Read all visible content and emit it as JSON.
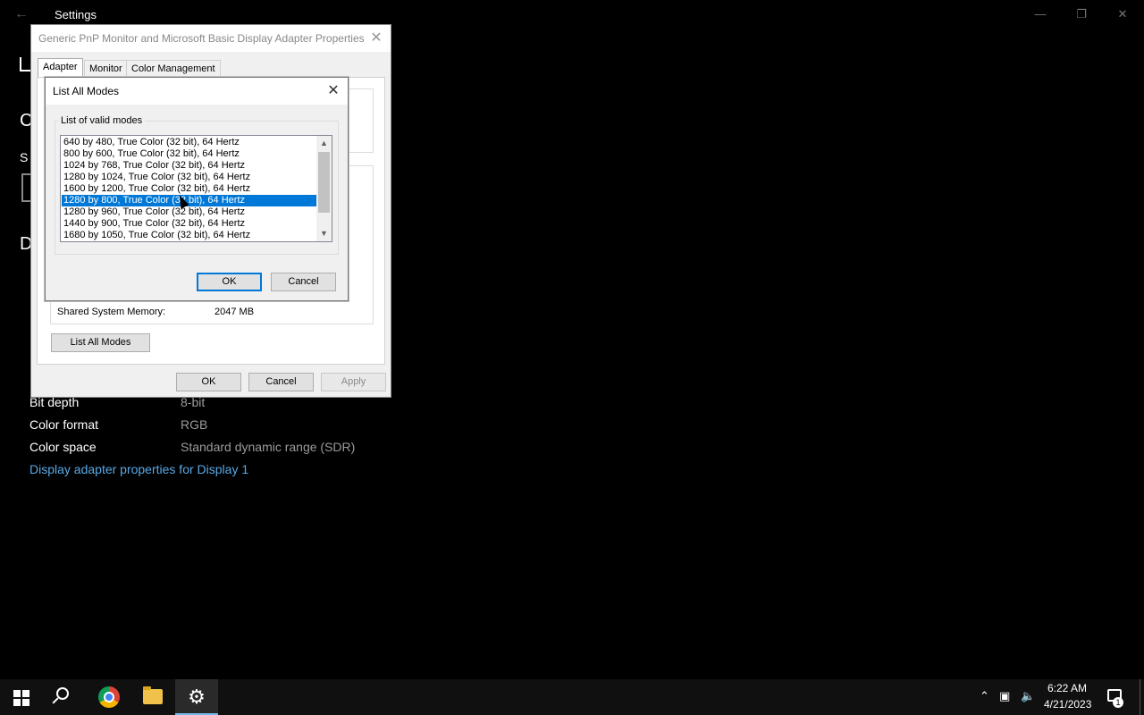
{
  "settings": {
    "title": "Settings",
    "sidebar_fragments": [
      "C",
      "S",
      "D"
    ],
    "info_rows": [
      {
        "label": "Bit depth",
        "value": "8-bit"
      },
      {
        "label": "Color format",
        "value": "RGB"
      },
      {
        "label": "Color space",
        "value": "Standard dynamic range (SDR)"
      }
    ],
    "adapter_link": "Display adapter properties for Display 1"
  },
  "properties_dialog": {
    "title": "Generic PnP Monitor and Microsoft Basic Display Adapter Properties",
    "tabs": [
      "Adapter",
      "Monitor",
      "Color Management"
    ],
    "shared_memory_label": "Shared System Memory:",
    "shared_memory_value": "2047 MB",
    "list_all_modes_button": "List All Modes",
    "ok_button": "OK",
    "cancel_button": "Cancel",
    "apply_button": "Apply"
  },
  "modes_dialog": {
    "title": "List All Modes",
    "group_label": "List of valid modes",
    "modes": [
      "640 by 480, True Color (32 bit), 64 Hertz",
      "800 by 600, True Color (32 bit), 64 Hertz",
      "1024 by 768, True Color (32 bit), 64 Hertz",
      "1280 by 1024, True Color (32 bit), 64 Hertz",
      "1600 by 1200, True Color (32 bit), 64 Hertz",
      "1280 by 800, True Color (32 bit), 64 Hertz",
      "1280 by 960, True Color (32 bit), 64 Hertz",
      "1440 by 900, True Color (32 bit), 64 Hertz",
      "1680 by 1050, True Color (32 bit), 64 Hertz"
    ],
    "selected_mode": "1280 by 800, True Color (32 bit), 64 Hertz",
    "ok_button": "OK",
    "cancel_button": "Cancel"
  },
  "taskbar": {
    "apps": [
      "start-icon",
      "search-icon",
      "chrome-icon",
      "file-explorer-icon",
      "settings-icon"
    ],
    "active_app": "settings-icon",
    "time": "6:22 AM",
    "date": "4/21/2023",
    "notification_count": "1"
  },
  "colors": {
    "accent": "#0078d7",
    "link": "#5aa9e6",
    "background": "#000000"
  }
}
